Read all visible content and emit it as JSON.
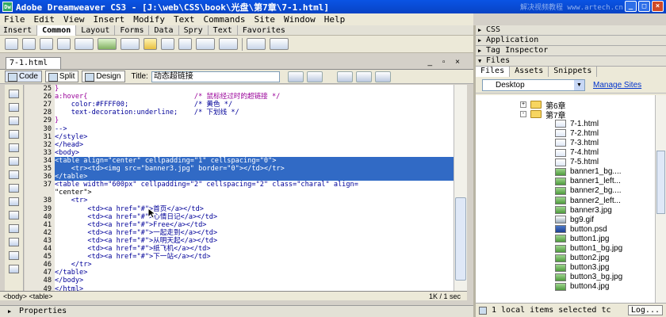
{
  "window": {
    "title": "Adobe Dreamweaver CS3 - [J:\\web\\CSS\\book\\光盘\\第7章\\7-1.html]",
    "watermark": "解决视频教程 www.artech.cn"
  },
  "menu": [
    "File",
    "Edit",
    "View",
    "Insert",
    "Modify",
    "Text",
    "Commands",
    "Site",
    "Window",
    "Help"
  ],
  "insert_bar": {
    "label": "Insert",
    "tabs": [
      "Common",
      "Layout",
      "Forms",
      "Data",
      "Spry",
      "Text",
      "Favorites"
    ],
    "active": "Common"
  },
  "document": {
    "tab": "7-1.html",
    "views": [
      "Code",
      "Split",
      "Design"
    ],
    "title_label": "Title:",
    "title_value": "动态超链接",
    "lines": [
      {
        "n": "25",
        "code": "}"
      },
      {
        "n": "26",
        "code": "a:hover{                          /* 鼠标经过时的超链接 */"
      },
      {
        "n": "27",
        "code": "    color:#FFFF00;                /* 黄色 */"
      },
      {
        "n": "28",
        "code": "    text-decoration:underline;    /* 下划线 */"
      },
      {
        "n": "29",
        "code": "}"
      },
      {
        "n": "30",
        "code": "-->"
      },
      {
        "n": "31",
        "code": "</style>"
      },
      {
        "n": "32",
        "code": "</head>"
      },
      {
        "n": "33",
        "code": "<body>"
      },
      {
        "n": "34",
        "code": "<table align=\"center\" cellpadding=\"1\" cellspacing=\"0\">"
      },
      {
        "n": "35",
        "code": "    <tr><td><img src=\"banner3.jpg\" border=\"0\"></td></tr>"
      },
      {
        "n": "36",
        "code": "</table>"
      },
      {
        "n": "37",
        "code": "<table width=\"600px\" cellpadding=\"2\" cellspacing=\"2\" class=\"charal\" align="
      },
      {
        "n": "",
        "code": "\"center\">"
      },
      {
        "n": "38",
        "code": "    <tr>"
      },
      {
        "n": "39",
        "code": "        <td><a href=\"#\">首页</a></td>"
      },
      {
        "n": "40",
        "code": "        <td><a href=\"#\">心情日记</a></td>"
      },
      {
        "n": "41",
        "code": "        <td><a href=\"#\">Free</a></td>"
      },
      {
        "n": "42",
        "code": "        <td><a href=\"#\">一起走到</a></td>"
      },
      {
        "n": "43",
        "code": "        <td><a href=\"#\">从明天起</a></td>"
      },
      {
        "n": "44",
        "code": "        <td><a href=\"#\">纸飞机</a></td>"
      },
      {
        "n": "45",
        "code": "        <td><a href=\"#\">下一站</a></td>"
      },
      {
        "n": "46",
        "code": "    </tr>"
      },
      {
        "n": "47",
        "code": "</table>"
      },
      {
        "n": "48",
        "code": "</body>"
      },
      {
        "n": "49",
        "code": "</html>"
      }
    ],
    "selected_lines": [
      9,
      10,
      11
    ],
    "tag_selector": "<body> <table>",
    "status_right": "1K / 1 sec"
  },
  "properties_label": "Properties",
  "panels": {
    "css": "CSS",
    "application": "Application",
    "tag_inspector": "Tag Inspector",
    "files": "Files"
  },
  "files_panel": {
    "tabs": [
      "Files",
      "Assets",
      "Snippets"
    ],
    "site": "Desktop",
    "manage_sites": "Manage Sites",
    "tree": [
      {
        "name": "第6章",
        "type": "folder",
        "expander": "+"
      },
      {
        "name": "第7章",
        "type": "folder",
        "expander": "-"
      },
      {
        "name": "7-1.html",
        "type": "html"
      },
      {
        "name": "7-2.html",
        "type": "html"
      },
      {
        "name": "7-3.html",
        "type": "html"
      },
      {
        "name": "7-4.html",
        "type": "html"
      },
      {
        "name": "7-5.html",
        "type": "html"
      },
      {
        "name": "banner1_bg....",
        "type": "img"
      },
      {
        "name": "banner1_left...",
        "type": "img"
      },
      {
        "name": "banner2_bg....",
        "type": "img"
      },
      {
        "name": "banner2_left...",
        "type": "img"
      },
      {
        "name": "banner3.jpg",
        "type": "img"
      },
      {
        "name": "bg9.gif",
        "type": "gif"
      },
      {
        "name": "button.psd",
        "type": "psd"
      },
      {
        "name": "button1.jpg",
        "type": "img"
      },
      {
        "name": "button1_bg.jpg",
        "type": "img"
      },
      {
        "name": "button2.jpg",
        "type": "img"
      },
      {
        "name": "button3.jpg",
        "type": "img"
      },
      {
        "name": "button3_bg.jpg",
        "type": "img"
      },
      {
        "name": "button4.jpg",
        "type": "img"
      }
    ],
    "status": "1 local items selected tc",
    "log_button": "Log..."
  }
}
